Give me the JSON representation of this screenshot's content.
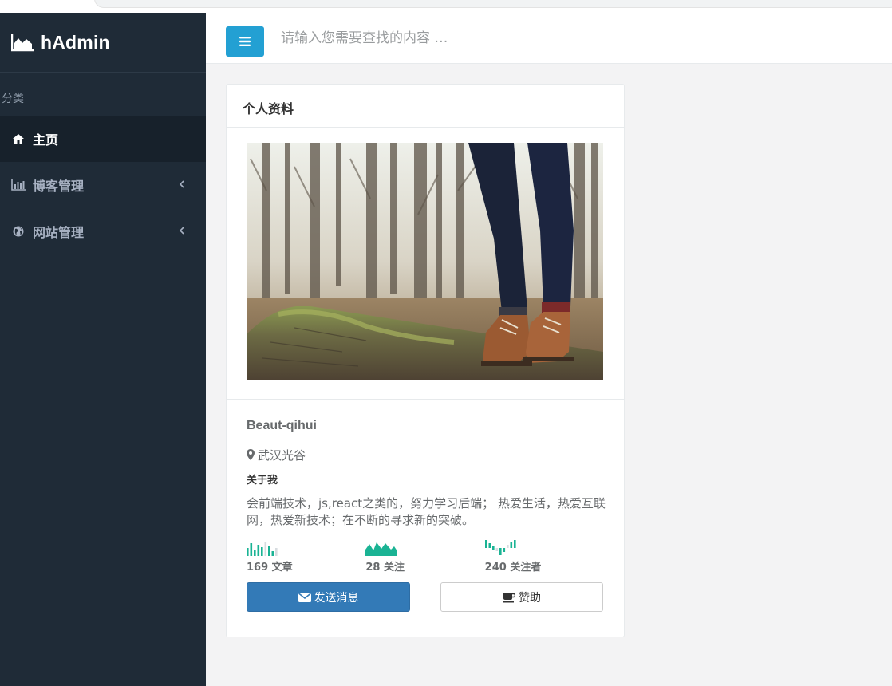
{
  "app": {
    "brand_name": "hAdmin"
  },
  "sidebar": {
    "header": "分类",
    "items": [
      {
        "label": "主页",
        "icon": "home-icon",
        "active": true
      },
      {
        "label": "博客管理",
        "icon": "bar-chart-icon",
        "active": false
      },
      {
        "label": "网站管理",
        "icon": "globe-icon",
        "active": false
      }
    ]
  },
  "topbar": {
    "search_placeholder": "请输入您需要查找的内容 …"
  },
  "profile_card": {
    "title": "个人资料",
    "name": "Beaut-qihui",
    "location": "武汉光谷",
    "about_title": "关于我",
    "about_text": "会前端技术，js,react之类的，努力学习后端； 热爱生活，热爱互联网，热爱新技术；在不断的寻求新的突破。",
    "stats": [
      {
        "label": "169 文章",
        "chart": "bar-sparkline"
      },
      {
        "label": "28 关注",
        "chart": "area-sparkline"
      },
      {
        "label": "240 关注者",
        "chart": "bar-sparkline-small"
      }
    ],
    "buttons": {
      "send_message": "发送消息",
      "sponsor": "赞助"
    }
  },
  "colors": {
    "sidebar_bg": "#1f2b37",
    "accent": "#23a0d3",
    "primary_button": "#337ab7",
    "sparkline": "#1ab394"
  }
}
